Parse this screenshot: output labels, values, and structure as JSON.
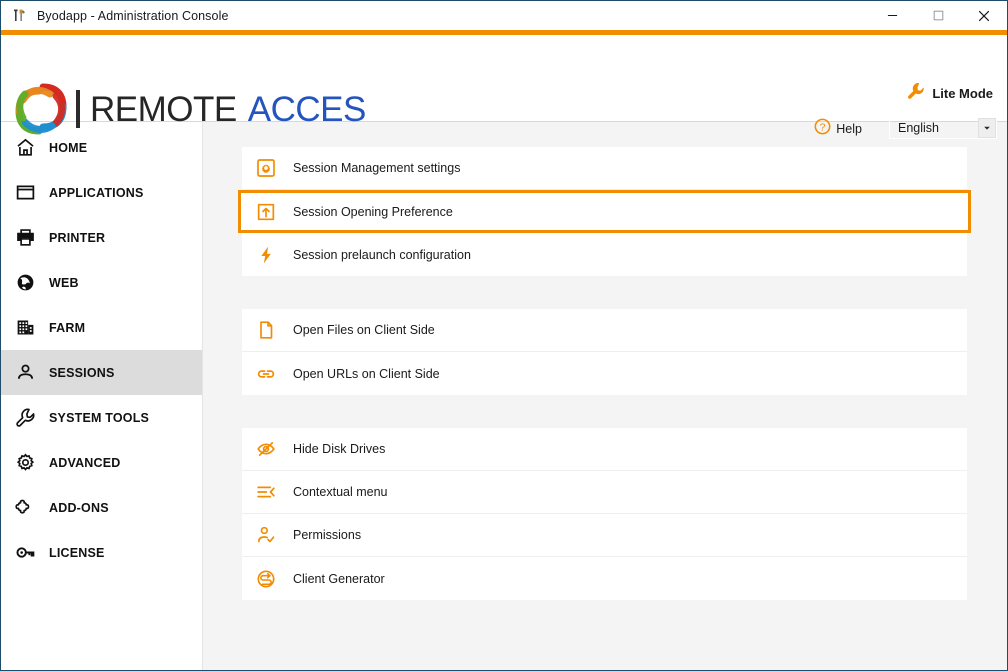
{
  "window": {
    "title": "Byodapp - Administration Console",
    "app_icon": "tools-icon",
    "controls": [
      {
        "name": "minimize",
        "glyph": "minimize-icon"
      },
      {
        "name": "maximize",
        "glyph": "maximize-icon"
      },
      {
        "name": "close",
        "glyph": "close-icon"
      }
    ]
  },
  "colors": {
    "accent_orange": "#F28C00",
    "brand_blue": "#2455BE",
    "border_navy": "#1d4d6b",
    "sidebar_active": "#dcdcdc",
    "content_bg": "#f4f4f4"
  },
  "header": {
    "logo_primary": "REMOTE",
    "logo_secondary": "ACCES",
    "logo_icon": "interlocking-rings-logo",
    "lite_mode": {
      "label": "Lite Mode",
      "icon": "wrench-icon"
    },
    "help": {
      "label": "Help",
      "icon": "help-circle-icon"
    },
    "language": {
      "value": "English",
      "icon": "chevron-down-icon"
    }
  },
  "sidebar": {
    "items": [
      {
        "label": "HOME",
        "icon": "home-icon",
        "active": false
      },
      {
        "label": "APPLICATIONS",
        "icon": "window-icon",
        "active": false
      },
      {
        "label": "PRINTER",
        "icon": "printer-icon",
        "active": false
      },
      {
        "label": "WEB",
        "icon": "globe-icon",
        "active": false
      },
      {
        "label": "FARM",
        "icon": "building-icon",
        "active": false
      },
      {
        "label": "SESSIONS",
        "icon": "person-icon",
        "active": true
      },
      {
        "label": "SYSTEM TOOLS",
        "icon": "wrench-icon",
        "active": false
      },
      {
        "label": "ADVANCED",
        "icon": "gear-icon",
        "active": false
      },
      {
        "label": "ADD-ONS",
        "icon": "puzzle-icon",
        "active": false
      },
      {
        "label": "LICENSE",
        "icon": "key-icon",
        "active": false
      }
    ]
  },
  "main": {
    "groups": [
      {
        "rows": [
          {
            "label": "Session Management settings",
            "icon": "gear-square-icon",
            "selected": false
          },
          {
            "label": "Session Opening Preference",
            "icon": "upload-box-icon",
            "selected": true
          },
          {
            "label": "Session prelaunch configuration",
            "icon": "lightning-icon",
            "selected": false
          }
        ]
      },
      {
        "rows": [
          {
            "label": "Open Files on Client Side",
            "icon": "document-icon",
            "selected": false
          },
          {
            "label": "Open URLs on Client Side",
            "icon": "link-icon",
            "selected": false
          }
        ]
      },
      {
        "rows": [
          {
            "label": "Hide Disk Drives",
            "icon": "eye-slash-icon",
            "selected": false
          },
          {
            "label": "Contextual menu",
            "icon": "menu-arrow-icon",
            "selected": false
          },
          {
            "label": "Permissions",
            "icon": "person-check-icon",
            "selected": false
          },
          {
            "label": "Client Generator",
            "icon": "circle-arrow-icon",
            "selected": false
          }
        ]
      }
    ]
  }
}
